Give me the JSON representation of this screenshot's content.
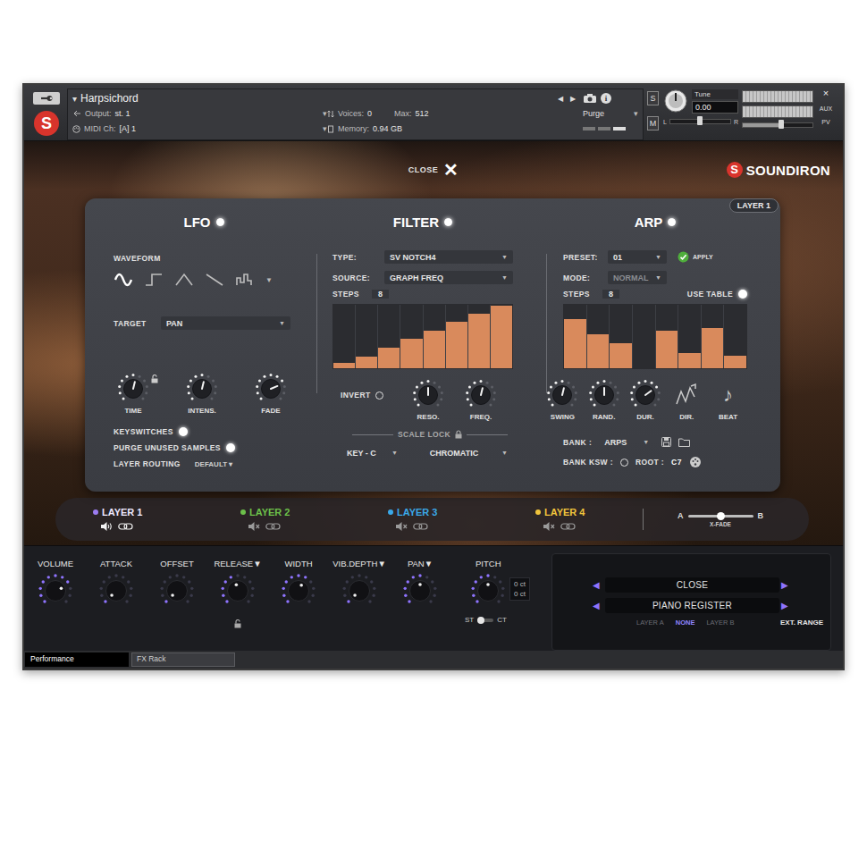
{
  "window": {
    "title": "Harpsichord"
  },
  "symbols": {
    "dropdown": "▼",
    "caret": "▾"
  },
  "header": {
    "logo_mark": "S",
    "nav": [
      "◀",
      "▶"
    ],
    "info": "i",
    "output_label": "Output:",
    "output": "st. 1",
    "voices_label": "Voices:",
    "voices": "0",
    "max_label": "Max:",
    "max": "512",
    "midi_label": "MIDI Ch:",
    "midi": "[A] 1",
    "memory_label": "Memory:",
    "memory": "0.94 GB",
    "purge": "Purge",
    "solo": {
      "label": "S",
      "on": false
    },
    "mute": {
      "label": "M",
      "on": false
    },
    "tune_label": "Tune",
    "tune": "0.00",
    "tune_level": 0.5,
    "pan_left": "L",
    "pan_right": "R",
    "pan_level": 0.5,
    "volume_level": 0.55,
    "close": "×",
    "aux": "AUX",
    "pv": "PV"
  },
  "overlay": {
    "close": "CLOSE",
    "close_icon": "✕",
    "brand_mark": "S",
    "brand": "SOUNDIRON",
    "layer_badge": "LAYER 1"
  },
  "lfo": {
    "title": "LFO",
    "on": true,
    "waveform_label": "WAVEFORM",
    "waveforms": [
      {
        "kind": "sine",
        "selected": true
      },
      {
        "kind": "square",
        "selected": false
      },
      {
        "kind": "triangle",
        "selected": false
      },
      {
        "kind": "saw",
        "selected": false
      },
      {
        "kind": "random",
        "selected": false
      }
    ],
    "target_label": "TARGET",
    "target": "PAN",
    "knobs": [
      {
        "label": "TIME",
        "level": 0.55
      },
      {
        "label": "INTENS.",
        "level": 0.55
      },
      {
        "label": "FADE",
        "level": 0.75
      }
    ],
    "time_locked": false,
    "toggles": [
      {
        "label": "KEYSWITCHES",
        "on": true
      },
      {
        "label": "PURGE UNUSED SAMPLES",
        "on": true
      }
    ],
    "routing_label": "LAYER ROUTING",
    "routing": "DEFAULT"
  },
  "filter": {
    "title": "FILTER",
    "on": true,
    "type_label": "TYPE:",
    "type": "SV NOTCH4",
    "source_label": "SOURCE:",
    "source": "GRAPH FREQ",
    "steps_label": "STEPS",
    "steps": "8",
    "bars": [
      0.08,
      0.19,
      0.33,
      0.46,
      0.59,
      0.73,
      0.86,
      0.99
    ],
    "invert": {
      "label": "INVERT",
      "on": false
    },
    "knobs": [
      {
        "label": "RESO.",
        "level": 0.5
      },
      {
        "label": "FREQ.",
        "level": 0.55
      }
    ],
    "scale_lock_label": "SCALE LOCK",
    "scale_locked": true,
    "key": "KEY - C",
    "scale": "CHROMATIC"
  },
  "arp": {
    "title": "ARP",
    "on": true,
    "preset_label": "PRESET:",
    "preset": "01",
    "apply": "APPLY",
    "mode_label": "MODE:",
    "mode": "NORMAL",
    "mode_disabled": true,
    "steps_label": "STEPS",
    "steps": "8",
    "use_table": {
      "label": "USE TABLE",
      "on": true
    },
    "bars": [
      0.77,
      0.54,
      0.39,
      0,
      0.59,
      0.24,
      0.63,
      0.2
    ],
    "knobs": [
      {
        "label": "SWING",
        "level": 0.55
      },
      {
        "label": "RAND.",
        "level": 0.5
      },
      {
        "label": "DUR.",
        "level": 0.7
      }
    ],
    "dir_label": "DIR.",
    "beat_label": "BEAT",
    "beat_icon": "♪",
    "bank_label": "BANK :",
    "bank": "ARPS",
    "bank_ksw_label": "BANK KSW :",
    "bank_ksw_on": false,
    "root_label": "ROOT :",
    "root": "C7"
  },
  "layers": {
    "items": [
      {
        "label": "LAYER 1",
        "color": "#9b7cf0",
        "selected": true,
        "muted": false
      },
      {
        "label": "LAYER 2",
        "color": "#6cc04a",
        "selected": false,
        "muted": true
      },
      {
        "label": "LAYER 3",
        "color": "#3aa8e8",
        "selected": false,
        "muted": true
      },
      {
        "label": "LAYER 4",
        "color": "#f0c43c",
        "selected": false,
        "muted": true
      }
    ],
    "xfade": {
      "left": "A",
      "right": "B",
      "label": "X-FADE",
      "level": 0.5
    }
  },
  "controls": {
    "knobs": [
      {
        "label": "VOLUME",
        "level": 0.75,
        "menu": false,
        "lock": null
      },
      {
        "label": "ATTACK",
        "level": 0,
        "menu": false,
        "lock": null
      },
      {
        "label": "OFFSET",
        "level": 0,
        "menu": false,
        "lock": null
      },
      {
        "label": "RELEASE",
        "level": 0.45,
        "menu": true,
        "lock": {
          "locked": false
        }
      },
      {
        "label": "WIDTH",
        "level": 0.6,
        "menu": false,
        "lock": null
      },
      {
        "label": "VIB.DEPTH",
        "level": 0,
        "menu": true,
        "lock": null
      },
      {
        "label": "PAN",
        "level": 0.5,
        "menu": true,
        "lock": null
      }
    ],
    "pitch": {
      "label": "PITCH",
      "level": 0.5,
      "readouts": [
        "0 ct",
        "0 ct"
      ],
      "switch": {
        "left": "ST",
        "right": "CT",
        "right_selected": false
      }
    }
  },
  "register": {
    "prev": "◀",
    "next": "▶",
    "rows": [
      "CLOSE",
      "PIANO REGISTER"
    ],
    "options": [
      {
        "label": "LAYER A",
        "selected": false
      },
      {
        "label": "NONE",
        "selected": true
      },
      {
        "label": "LAYER B",
        "selected": false
      }
    ],
    "ext_range": "EXT. RANGE"
  },
  "tabs": [
    {
      "label": "Performance",
      "selected": true
    },
    {
      "label": "FX Rack",
      "selected": false
    }
  ]
}
